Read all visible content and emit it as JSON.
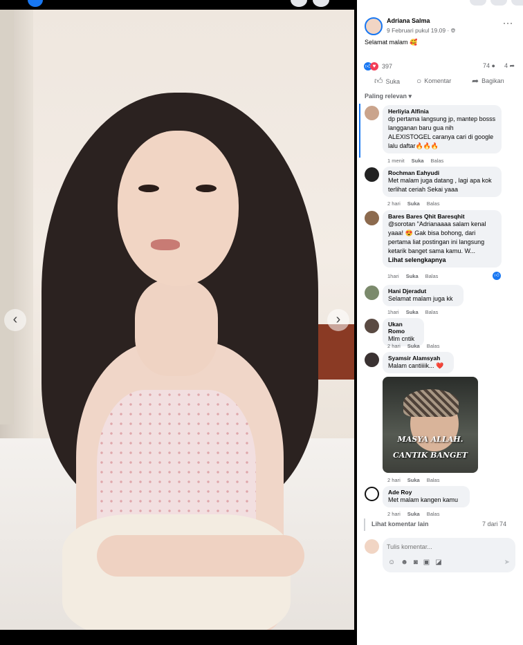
{
  "post": {
    "author": "Adriana Salma",
    "timestamp": "9 Februari pukul 19.09 · ",
    "privacy_icon": "globe-icon",
    "caption": "Selamat malam 🥰",
    "reactions_count": "397",
    "comments_count": "74",
    "shares_count": "4",
    "accent_color": "#1877f2"
  },
  "actions": {
    "like": "Suka",
    "comment": "Komentar",
    "share": "Bagikan"
  },
  "sort_label": "Paling relevan",
  "comments": [
    {
      "name": "Herliyia Alfinia",
      "text": "dp pertama langsung jp, mantep bosss langganan baru gua nih ALEXISTOGEL caranya cari di google lalu daftar🔥🔥🔥",
      "time": "1 menit",
      "like": "Suka",
      "reply": "Balas"
    },
    {
      "name": "Rochman Eahyudi",
      "text": "Met malam juga datang , lagi apa kok terlihat ceriah Sekai yaaa",
      "time": "2 hari",
      "like": "Suka",
      "reply": "Balas"
    },
    {
      "name": "Bares Bares Qhit Baresqhit",
      "text": "@sorotan \"Adrianaaaa salam kenal yaaa! 😍 Gak bisa bohong, dari pertama liat postingan ini langsung ketarik banget sama kamu. W...",
      "see_more": "Lihat selengkapnya",
      "time": "1hari",
      "like": "Suka",
      "reply": "Balas"
    },
    {
      "name": "Hani Djeradut",
      "text": "Selamat malam juga kk",
      "time": "1hari",
      "like": "Suka",
      "reply": "Balas"
    },
    {
      "name": "Ukan Romo",
      "text": "Mlm cntik",
      "time": "2 hari",
      "like": "Suka",
      "reply": "Balas"
    },
    {
      "name": "Syamsir Alamsyah",
      "text": "Malam cantiiiik... ❤️",
      "sticker_text_1": "MASYA ALLAH.",
      "sticker_text_2": "CANTIK BANGET",
      "time": "2 hari",
      "like": "Suka",
      "reply": "Balas"
    },
    {
      "name": "Ade Roy",
      "text": "Met malam kangen kamu",
      "time": "2 hari",
      "like": "Suka",
      "reply": "Balas"
    }
  ],
  "more_comments": "Lihat komentar lain",
  "comments_page": "7 dari 74",
  "composer": {
    "placeholder": "Tulis komentar..."
  }
}
